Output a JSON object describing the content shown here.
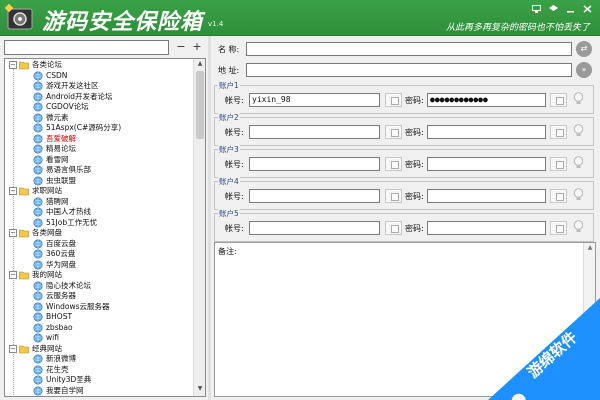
{
  "window": {
    "title": "游码安全保险箱",
    "version": "v1.4",
    "slogan": "从此再多再复杂的密码也不怕丢失了",
    "controls": [
      "minimize",
      "settings",
      "menu",
      "close"
    ],
    "accent": "#2f8f3b"
  },
  "left": {
    "search": {
      "value": "",
      "placeholder": ""
    },
    "remove_label": "−",
    "add_label": "+"
  },
  "tree": [
    {
      "type": "category",
      "label": "各类论坛",
      "expanded": true
    },
    {
      "type": "site",
      "label": "CSDN"
    },
    {
      "type": "site",
      "label": "游戏开发这社区"
    },
    {
      "type": "site",
      "label": "Android开发者论坛"
    },
    {
      "type": "site",
      "label": "CGDOV论坛"
    },
    {
      "type": "site",
      "label": "微元素"
    },
    {
      "type": "site",
      "label": "51Aspx(C#源码分享)"
    },
    {
      "type": "site",
      "label": "吾爱破解",
      "highlight": true
    },
    {
      "type": "site",
      "label": "精易论坛"
    },
    {
      "type": "site",
      "label": "看雪网"
    },
    {
      "type": "site",
      "label": "易语言俱乐部"
    },
    {
      "type": "site",
      "label": "虫虫联盟"
    },
    {
      "type": "category",
      "label": "求职网站",
      "expanded": true
    },
    {
      "type": "site",
      "label": "猎聘网"
    },
    {
      "type": "site",
      "label": "中国人才热线"
    },
    {
      "type": "site",
      "label": "51Job工作无忧"
    },
    {
      "type": "category",
      "label": "各类网盘",
      "expanded": true
    },
    {
      "type": "site",
      "label": "百度云盘"
    },
    {
      "type": "site",
      "label": "360云盘"
    },
    {
      "type": "site",
      "label": "华为网盘"
    },
    {
      "type": "category",
      "label": "我的网站",
      "expanded": true
    },
    {
      "type": "site",
      "label": "隐心技术论坛"
    },
    {
      "type": "site",
      "label": "云服务器"
    },
    {
      "type": "site",
      "label": "Windows云服务器"
    },
    {
      "type": "site",
      "label": "BHOST"
    },
    {
      "type": "site",
      "label": "zbsbao"
    },
    {
      "type": "site",
      "label": "wifi"
    },
    {
      "type": "category",
      "label": "经典网站",
      "expanded": true
    },
    {
      "type": "site",
      "label": "新浪微博"
    },
    {
      "type": "site",
      "label": "花生壳"
    },
    {
      "type": "site",
      "label": "Unity3D圣典"
    },
    {
      "type": "site",
      "label": "我要自学网"
    }
  ],
  "form": {
    "name_label": "名 称:",
    "name_value": "",
    "address_label": "地 址:",
    "address_value": "",
    "account_label": "帐号:",
    "password_label": "密码:",
    "accounts": [
      {
        "title": "账户1",
        "username": "yixin_98",
        "password": "●●●●●●●●●●●●"
      },
      {
        "title": "账户2",
        "username": "",
        "password": ""
      },
      {
        "title": "账户3",
        "username": "",
        "password": ""
      },
      {
        "title": "账户4",
        "username": "",
        "password": ""
      },
      {
        "title": "账户5",
        "username": "",
        "password": ""
      }
    ],
    "notes_label": "备注:",
    "notes_value": ""
  },
  "watermark": {
    "text": "游绵软件",
    "color": "#1e90ff"
  }
}
